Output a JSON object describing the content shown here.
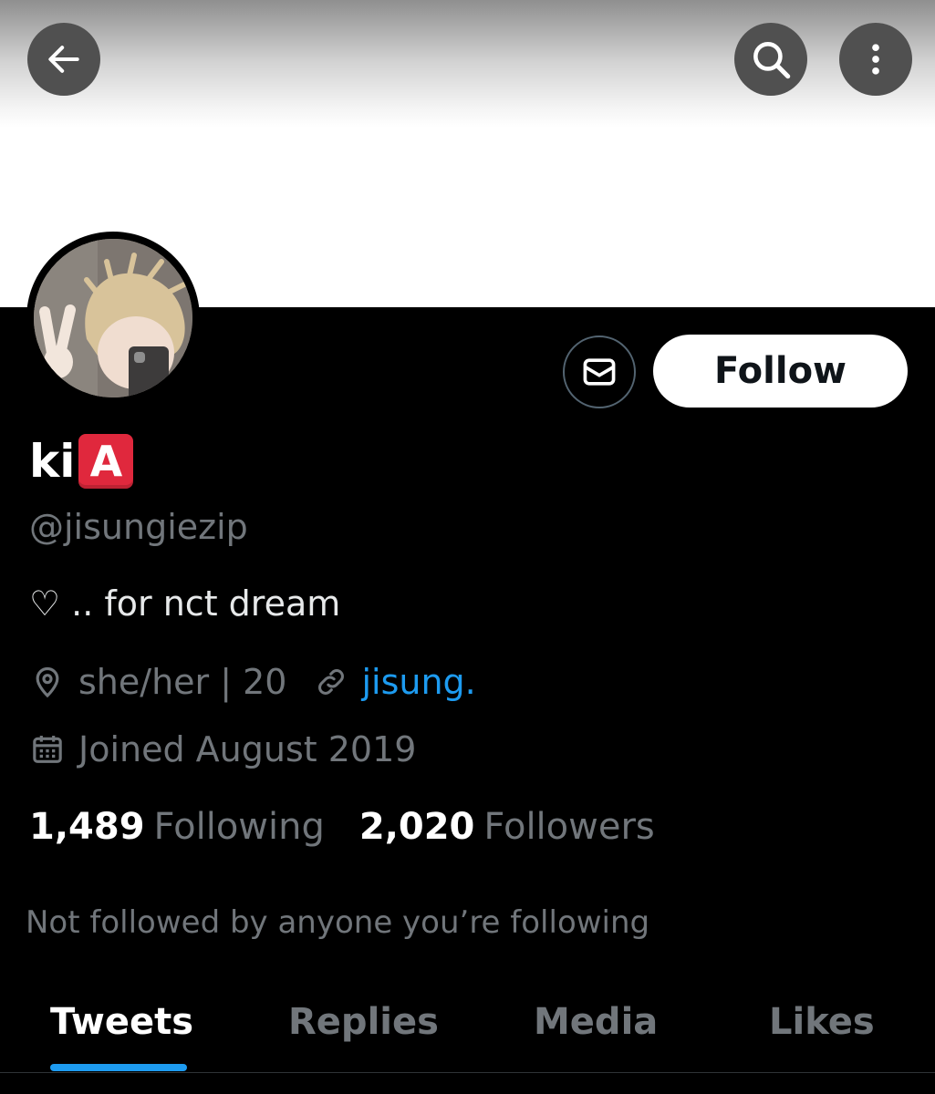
{
  "profile": {
    "display_name": "ki",
    "name_emoji": "A",
    "handle": "@jisungiezip",
    "bio": "♡ .. for nct dream",
    "location": "she/her | 20",
    "website": "jisung.",
    "joined": "Joined August 2019"
  },
  "stats": {
    "following_count": "1,489",
    "following_label": "Following",
    "followers_count": "2,020",
    "followers_label": "Followers"
  },
  "actions": {
    "follow_label": "Follow"
  },
  "not_followed_text": "Not followed by anyone you’re following",
  "tabs": [
    {
      "label": "Tweets"
    },
    {
      "label": "Replies"
    },
    {
      "label": "Media"
    },
    {
      "label": "Likes"
    }
  ],
  "colors": {
    "accent": "#1d9bf0",
    "emoji_red": "#e0283d",
    "muted_text": "#71767b"
  }
}
